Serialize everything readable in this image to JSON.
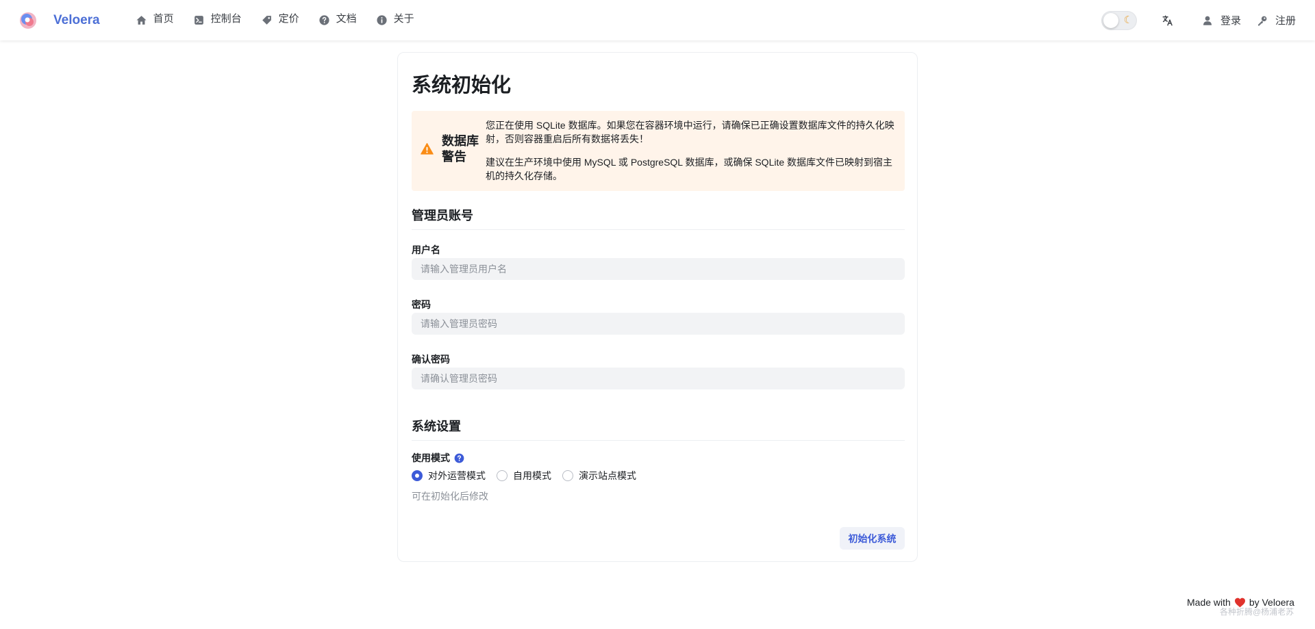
{
  "brand": {
    "name": "Veloera",
    "logo_icon": "veloera-logo-icon"
  },
  "nav": [
    {
      "label": "首页",
      "icon": "home-icon"
    },
    {
      "label": "控制台",
      "icon": "terminal-icon"
    },
    {
      "label": "定价",
      "icon": "price-tag-icon"
    },
    {
      "label": "文档",
      "icon": "question-circle-icon"
    },
    {
      "label": "关于",
      "icon": "info-circle-icon"
    }
  ],
  "toolbar": {
    "theme_icon": "moon-icon",
    "language_icon": "translate-icon",
    "login_label": "登录",
    "register_label": "注册"
  },
  "page": {
    "title": "系统初始化"
  },
  "warning": {
    "title": "数据库警告",
    "paragraph1": "您正在使用 SQLite 数据库。如果您在容器环境中运行，请确保已正确设置数据库文件的持久化映射，否则容器重启后所有数据将丢失！",
    "paragraph2": "建议在生产环境中使用 MySQL 或 PostgreSQL 数据库，或确保 SQLite 数据库文件已映射到宿主机的持久化存储。",
    "icon": "warning-triangle-icon",
    "color": "#fa8c16"
  },
  "admin": {
    "section_title": "管理员账号",
    "username_label": "用户名",
    "username_placeholder": "请输入管理员用户名",
    "password_label": "密码",
    "password_placeholder": "请输入管理员密码",
    "confirm_label": "确认密码",
    "confirm_placeholder": "请确认管理员密码"
  },
  "system": {
    "section_title": "系统设置",
    "mode_label": "使用模式",
    "mode_options": [
      "对外运营模式",
      "自用模式",
      "演示站点模式"
    ],
    "selected_mode": "对外运营模式",
    "hint": "可在初始化后修改",
    "submit_label": "初始化系统"
  },
  "footer": {
    "made_with": "Made with",
    "by": "by Veloera",
    "watermark": "各种折腾@杨浦老苏"
  },
  "colors": {
    "accent": "#3d5bd8",
    "brand": "#4c6fd6",
    "warning_bg": "#fff4ea"
  }
}
